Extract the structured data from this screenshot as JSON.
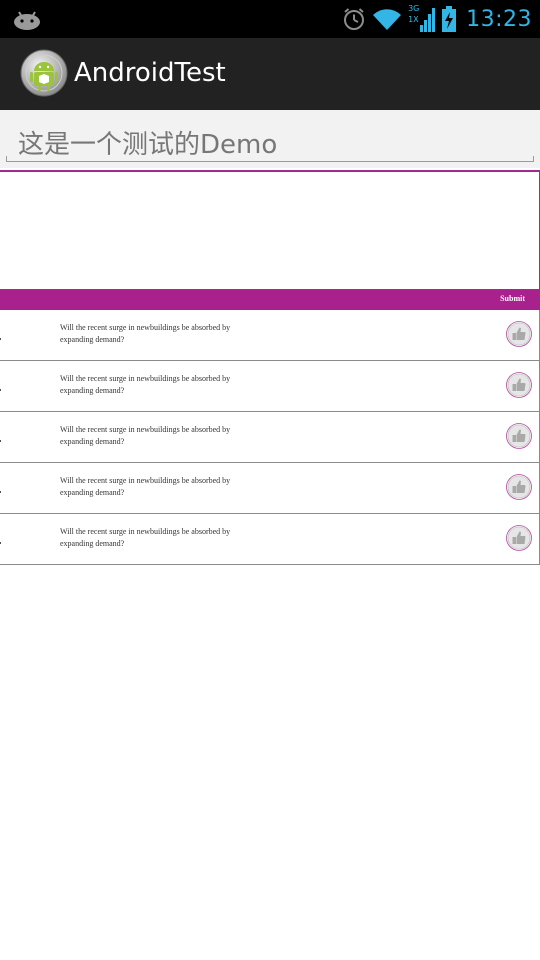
{
  "status_bar": {
    "time": "13:23",
    "network_type_top": "3G",
    "network_type_bottom": "1X",
    "icons": [
      "android-debug-icon",
      "alarm-clock-icon",
      "wifi-icon",
      "cellular-signal-icon",
      "battery-charging-icon"
    ],
    "accent_color": "#33b5e5"
  },
  "action_bar": {
    "title": "AndroidTest",
    "logo_icon": "android-app-logo-icon"
  },
  "text_field": {
    "value": "这是一个测试的Demo"
  },
  "submit_bar": {
    "label": "Submit",
    "color": "#a8218c"
  },
  "webview": {
    "border_color": "#9c2b94"
  },
  "questions": [
    {
      "line1": "Will the recent surge in newbuildings be absorbed by",
      "line2": "expanding demand?",
      "icon": "thumbs-up-icon"
    },
    {
      "line1": "Will the recent surge in newbuildings be absorbed by",
      "line2": "expanding demand?",
      "icon": "thumbs-up-icon"
    },
    {
      "line1": "Will the recent surge in newbuildings be absorbed by",
      "line2": "expanding demand?",
      "icon": "thumbs-up-icon"
    },
    {
      "line1": "Will the recent surge in newbuildings be absorbed by",
      "line2": "expanding demand?",
      "icon": "thumbs-up-icon"
    },
    {
      "line1": "Will the recent surge in newbuildings be absorbed by",
      "line2": "expanding demand?",
      "icon": "thumbs-up-icon"
    }
  ]
}
